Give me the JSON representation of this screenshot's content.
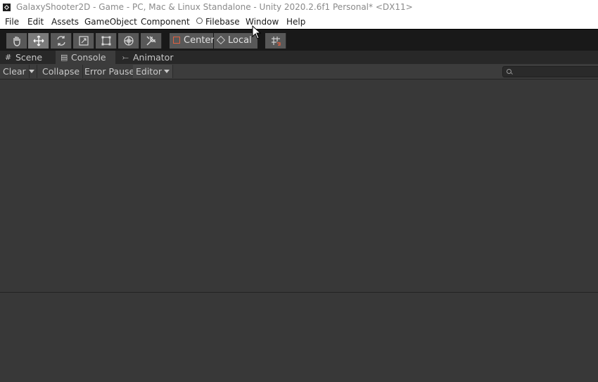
{
  "window": {
    "title": "GalaxyShooter2D - Game - PC, Mac & Linux Standalone - Unity 2020.2.6f1 Personal* <DX11>"
  },
  "menu": {
    "items": [
      "File",
      "Edit",
      "Assets",
      "GameObject",
      "Component",
      "Filebase",
      "Window",
      "Help"
    ]
  },
  "toolbar": {
    "tools": [
      "hand-tool",
      "move-tool",
      "rotate-tool",
      "scale-tool",
      "rect-tool",
      "transform-tool",
      "custom-tool"
    ],
    "active_tool": "move-tool",
    "pivot_mode": "Center",
    "pivot_rotation": "Local",
    "grid_snap_icon": "grid-snap-icon"
  },
  "tabs": [
    {
      "label": "Scene",
      "icon": "grid-icon"
    },
    {
      "label": "Console",
      "icon": "console-icon"
    },
    {
      "label": "Animator",
      "icon": "animator-icon"
    }
  ],
  "active_tab": "Console",
  "console_toolbar": {
    "clear": "Clear",
    "collapse": "Collapse",
    "error_pause": "Error Pause",
    "editor": "Editor",
    "search_placeholder": ""
  },
  "colors": {
    "window_bg": "#383838",
    "toolbar_bg": "#191919",
    "active_tool_bg": "#7b7b7b",
    "accent_red": "#e06040"
  }
}
